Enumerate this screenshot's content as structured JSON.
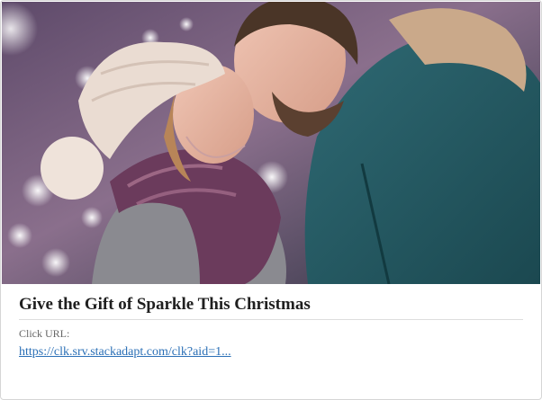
{
  "ad": {
    "image_alt": "Couple embracing in winter clothing at night",
    "headline": "Give the Gift of Sparkle This Christmas",
    "click_label": "Click URL:",
    "click_url_text": "https://clk.srv.stackadapt.com/clk?aid=1..."
  },
  "colors": {
    "link": "#2a6fb6",
    "headline": "#1f1f1f",
    "label": "#666666",
    "border": "#d6d6d6"
  }
}
